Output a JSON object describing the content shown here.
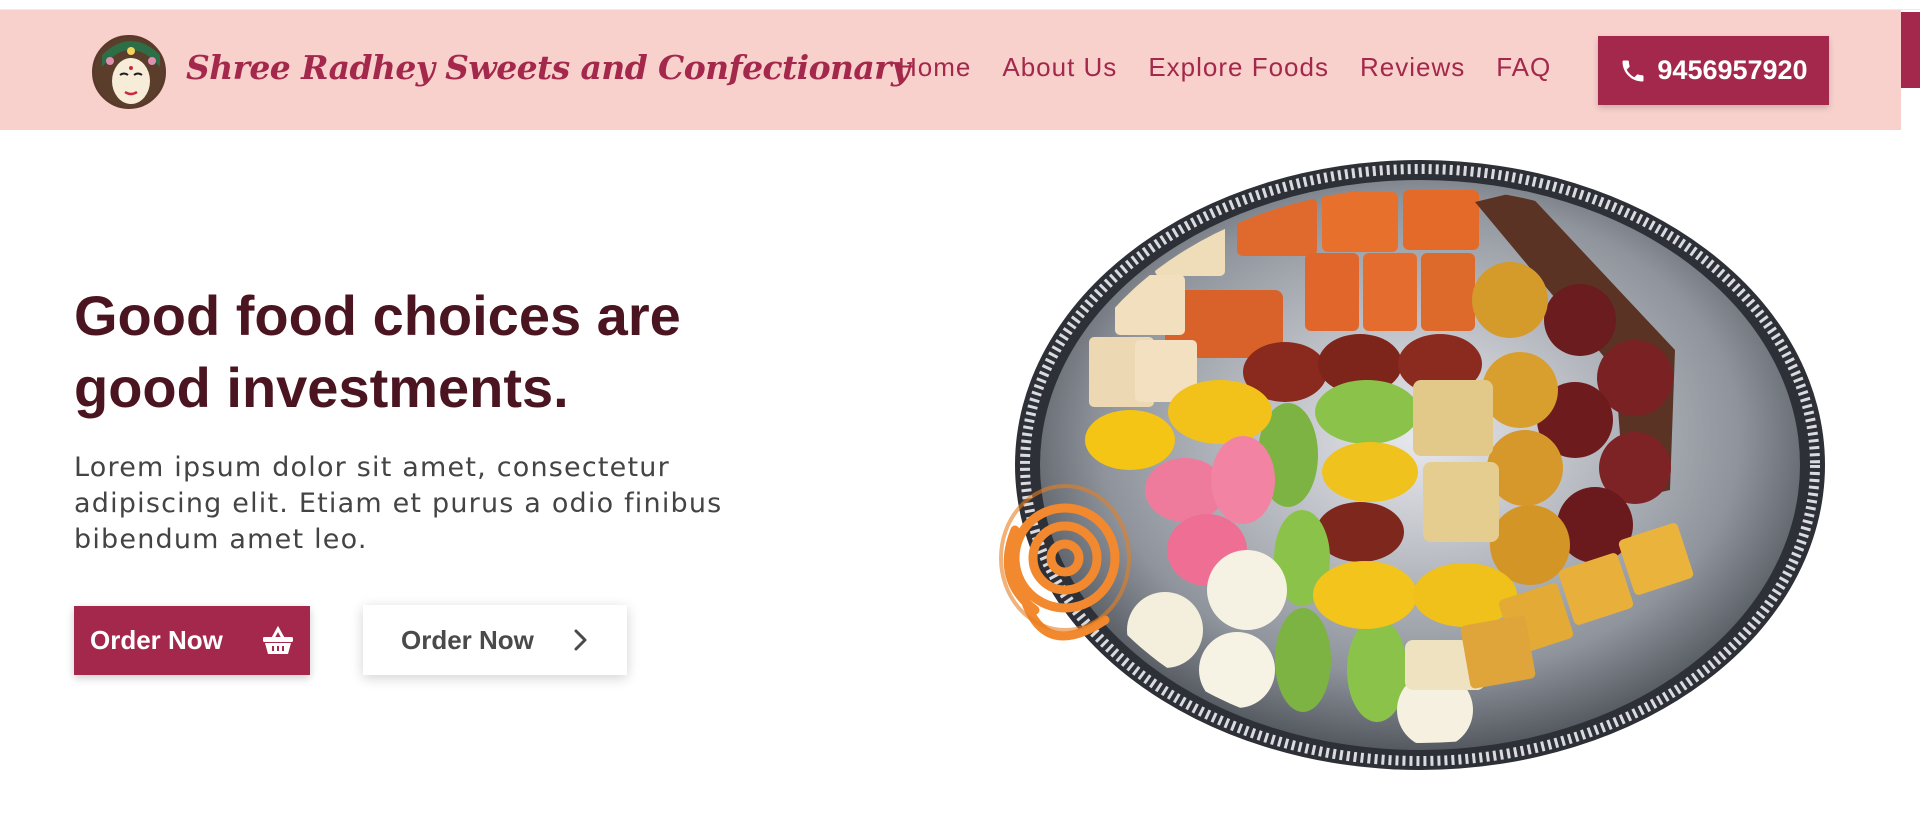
{
  "header": {
    "brand_name": "Shree Radhey Sweets and Confectionary",
    "nav": [
      "Home",
      "About Us",
      "Explore Foods",
      "Reviews",
      "FAQ"
    ],
    "phone": "9456957920"
  },
  "hero": {
    "title_line1": "Good food choices are",
    "title_line2": "good investments.",
    "text_line1": "Lorem ipsum dolor sit amet, consectetur",
    "text_line2": "adipiscing elit. Etiam et purus a odio finibus",
    "text_line3": "bibendum amet leo.",
    "primary_button": "Order Now",
    "secondary_button": "Order Now"
  },
  "icons": {
    "phone": "phone-icon",
    "basket": "basket-icon",
    "chevron": "chevron-right-icon"
  },
  "colors": {
    "brand": "#a3284b",
    "navbar_bg": "#f8d1cd",
    "title": "#4a1420",
    "body_text": "#444444"
  }
}
